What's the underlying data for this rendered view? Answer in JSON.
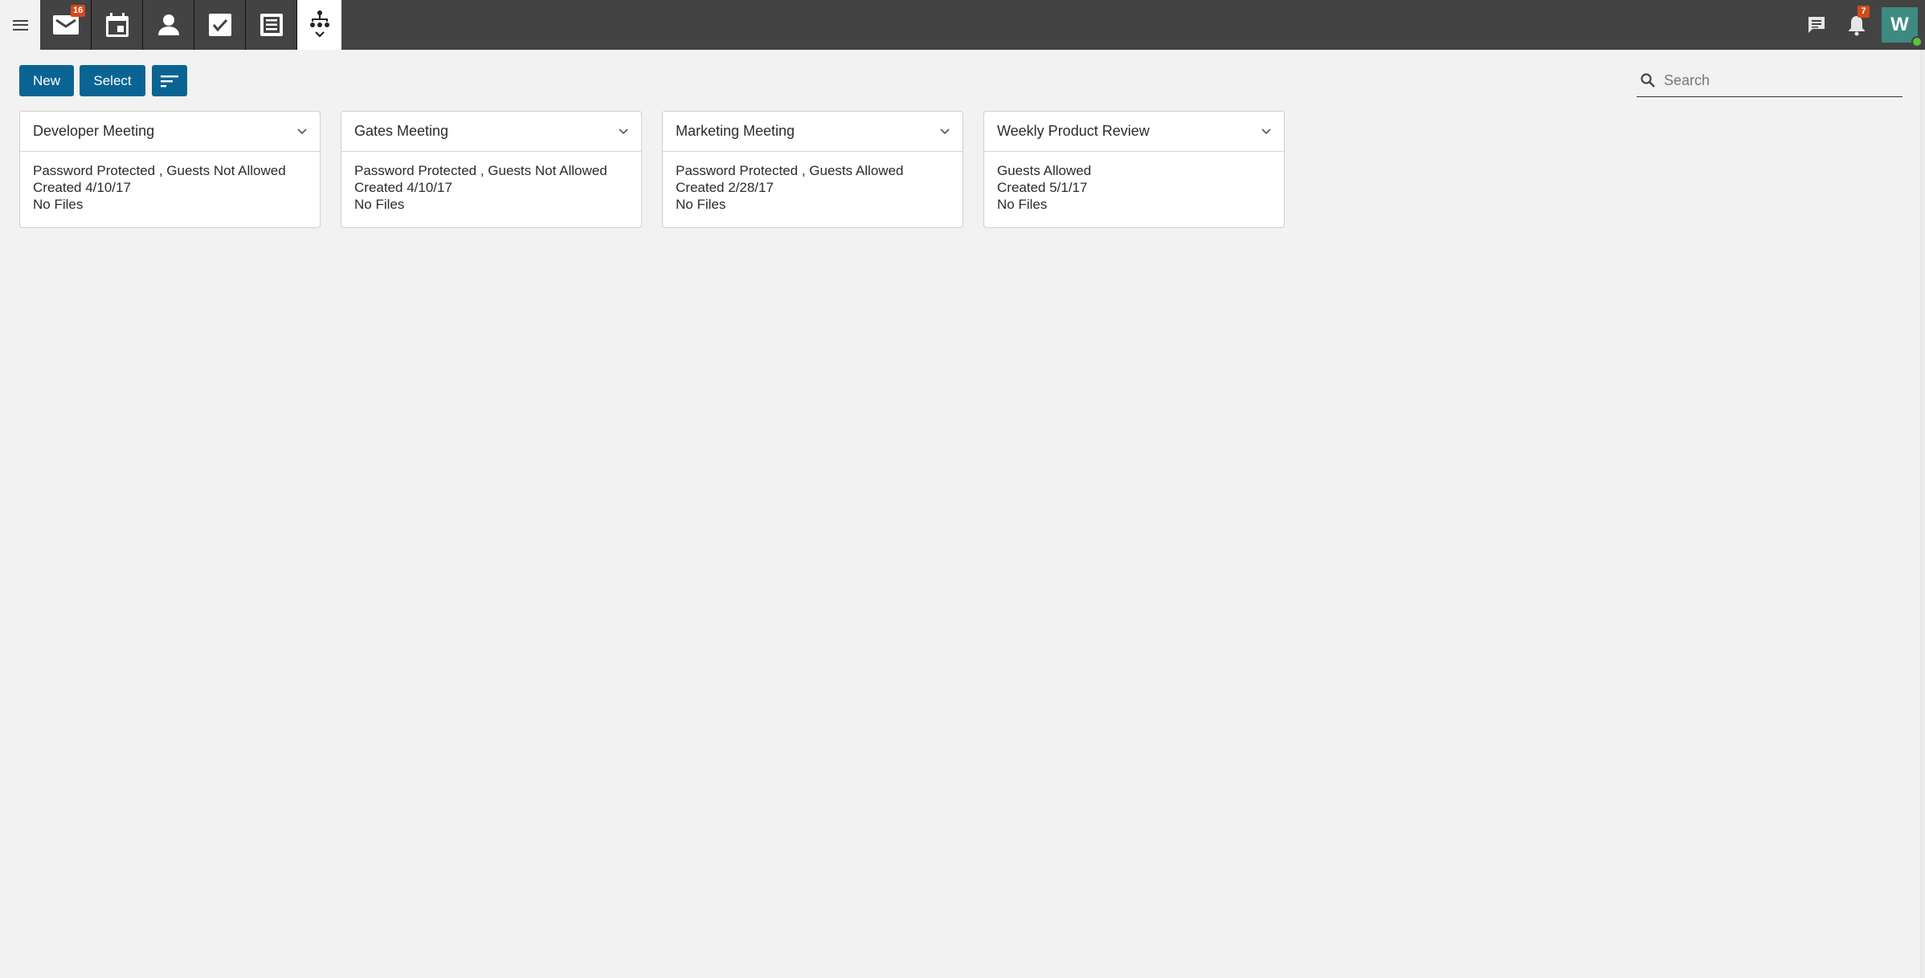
{
  "nav": {
    "menu_icon": "hamburger-menu-icon",
    "apps": [
      {
        "name": "mail",
        "icon": "mail-icon",
        "badge": "16",
        "active": false
      },
      {
        "name": "calendar",
        "icon": "calendar-icon",
        "badge": null,
        "active": false
      },
      {
        "name": "contacts",
        "icon": "person-icon",
        "badge": null,
        "active": false
      },
      {
        "name": "tasks",
        "icon": "checkbox-icon",
        "badge": null,
        "active": false
      },
      {
        "name": "notes",
        "icon": "list-document-icon",
        "badge": null,
        "active": false
      },
      {
        "name": "meetings",
        "icon": "org-hierarchy-icon",
        "badge": null,
        "active": true
      }
    ],
    "chat_icon": "chat-icon",
    "notifications_badge": "7",
    "avatar_initial": "W",
    "presence_color": "#5cc23b",
    "avatar_color": "#3d8b80"
  },
  "toolbar": {
    "new_label": "New",
    "select_label": "Select",
    "sort_icon": "sort-icon",
    "accent": "#0a6493"
  },
  "search": {
    "placeholder": "Search",
    "value": ""
  },
  "cards": [
    {
      "title": "Developer Meeting",
      "settings": "Password Protected , Guests Not Allowed",
      "created": "Created 4/10/17",
      "files": "No Files"
    },
    {
      "title": "Gates Meeting",
      "settings": "Password Protected , Guests Not Allowed",
      "created": "Created 4/10/17",
      "files": "No Files"
    },
    {
      "title": "Marketing Meeting",
      "settings": "Password Protected , Guests Allowed",
      "created": "Created 2/28/17",
      "files": "No Files"
    },
    {
      "title": "Weekly Product Review",
      "settings": "Guests Allowed",
      "created": "Created 5/1/17",
      "files": "No Files"
    }
  ]
}
